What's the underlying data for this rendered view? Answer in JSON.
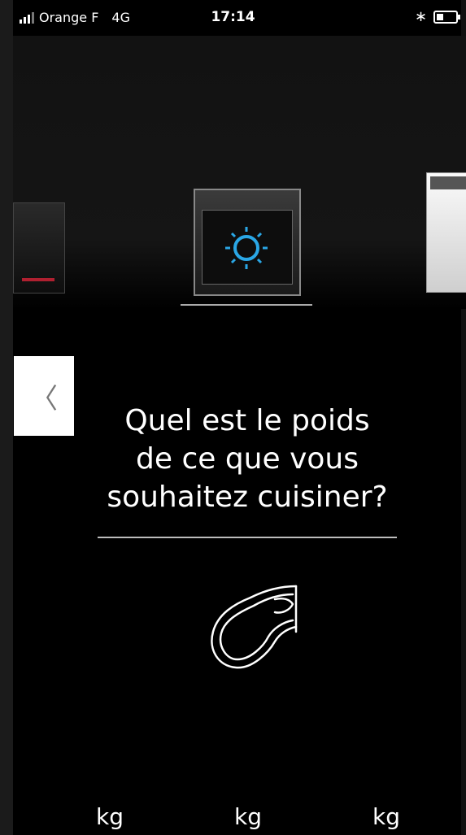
{
  "status_bar": {
    "carrier": "Orange F",
    "network": "4G",
    "time": "17:14",
    "icons": [
      "signal-icon",
      "bluetooth-icon",
      "battery-icon"
    ]
  },
  "carousel": {
    "items": [
      "cooktop",
      "oven",
      "dishwasher"
    ]
  },
  "back_button": {
    "label": "〈",
    "icon": "chevron-left-icon"
  },
  "question": {
    "line1": "Quel est le poids",
    "line2": "de ce que vous",
    "line3": "souhaitez cuisiner?"
  },
  "food_icon": "meat-icon",
  "weight_units": [
    "kg",
    "kg",
    "kg"
  ],
  "colors": {
    "background": "#000000",
    "text": "#ffffff",
    "accent": "#2aa7e6"
  }
}
